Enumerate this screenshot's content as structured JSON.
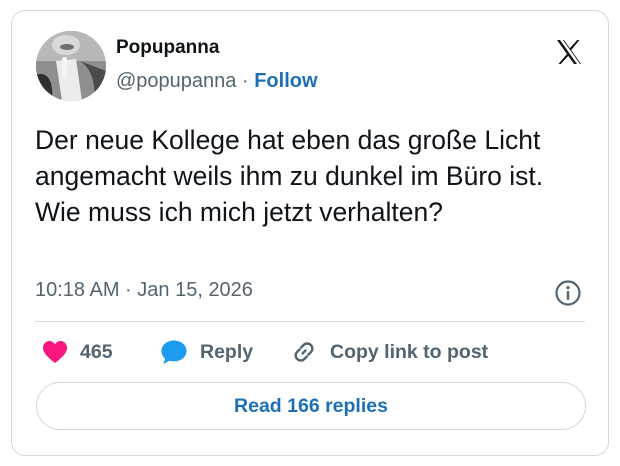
{
  "author": {
    "display_name": "Popupanna",
    "handle": "@popupanna",
    "separator": "·",
    "follow_label": "Follow"
  },
  "tweet": {
    "text": "Der neue Kollege hat eben das große Licht angemacht weils ihm zu dunkel im Büro ist. Wie muss ich mich jetzt verhalten?",
    "timestamp": "10:18 AM · Jan 15, 2026"
  },
  "actions": {
    "likes_count": "465",
    "reply_label": "Reply",
    "copy_link_label": "Copy link to post"
  },
  "read_replies_label": "Read 166 replies",
  "colors": {
    "like": "#f91880",
    "reply": "#1d9bf0",
    "link": "#1d70b8",
    "secondary_text": "#536471",
    "border": "#cfd9de"
  },
  "icons": [
    "x-logo-icon",
    "info-icon",
    "heart-icon",
    "reply-bubble-icon",
    "link-icon"
  ]
}
